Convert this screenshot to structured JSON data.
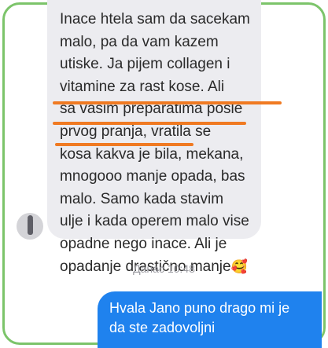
{
  "incoming_message": {
    "lines": [
      "Inace htela sam da sacekam",
      "malo, pa da vam kazem",
      "utiske. Ja pijem collagen i",
      "vitamine za rast kose. Ali",
      "sa vasim preparatima posle",
      "prvog pranja, vratila se",
      "kosa kakva je bila, mekana,",
      "mnogooo manje opada, bas",
      "malo. Samo kada stavim",
      "ulje i kada operem malo vise",
      "opadne nego inace. Ali je",
      "opadanje drastično manje"
    ],
    "emoji": "🥰"
  },
  "timestamp": "Данас 10:48",
  "outgoing_message": {
    "lines": [
      "Hvala Jano puno drago mi je",
      "da ste zadovoljni"
    ]
  },
  "colors": {
    "frame_border": "#7cc46a",
    "incoming_bubble": "#ececf0",
    "outgoing_bubble": "#1f82ee",
    "highlight_underline": "#f07a22"
  },
  "icons": {
    "avatar": "avatar-icon"
  }
}
